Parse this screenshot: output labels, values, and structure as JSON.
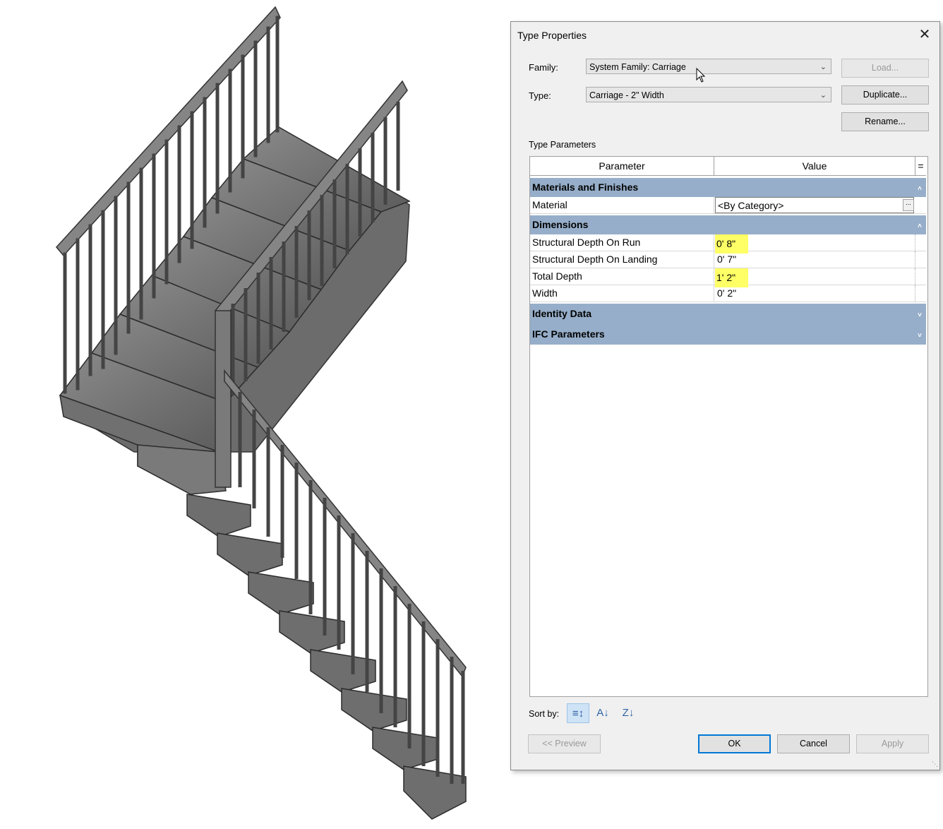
{
  "dialog": {
    "title": "Type Properties",
    "family_label": "Family:",
    "family_value": "System Family: Carriage",
    "type_label": "Type:",
    "type_value": "Carriage - 2\" Width",
    "load_label": "Load...",
    "duplicate_label": "Duplicate...",
    "rename_label": "Rename...",
    "type_parameters_label": "Type Parameters",
    "grid": {
      "col_parameter": "Parameter",
      "col_value": "Value",
      "col_eq": "=",
      "groups": {
        "materials": "Materials and Finishes",
        "dimensions": "Dimensions",
        "identity": "Identity Data",
        "ifc": "IFC Parameters"
      },
      "rows": {
        "material": {
          "name": "Material",
          "value": "<By Category>"
        },
        "depth_run": {
          "name": "Structural Depth On Run",
          "value": "0'  8\""
        },
        "depth_landing": {
          "name": "Structural Depth On Landing",
          "value": "0'  7\""
        },
        "total_depth": {
          "name": "Total Depth",
          "value": "1'  2\""
        },
        "width": {
          "name": "Width",
          "value": "0'  2\""
        }
      },
      "browse_button": "..."
    },
    "sort_by_label": "Sort by:",
    "preview_label": "<< Preview",
    "ok_label": "OK",
    "cancel_label": "Cancel",
    "apply_label": "Apply",
    "highlight_color": "#ffff66",
    "group_color": "#96aec9"
  }
}
